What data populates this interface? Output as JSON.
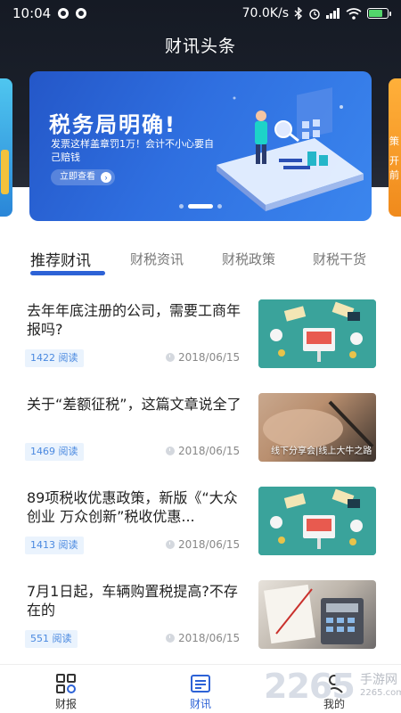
{
  "status_bar": {
    "time": "10:04",
    "network_speed": "70.0K/s",
    "battery_color": "#52d66b"
  },
  "header": {
    "title": "财讯头条"
  },
  "banner": {
    "heading": "税务局明确!",
    "description": "发票这样盖章罚1万！会计不小心要自己赔钱",
    "button_label": "立即查看",
    "active_slide": 2,
    "slide_count": 3,
    "right_peek_text": [
      "策",
      "开",
      "前"
    ]
  },
  "tabs": [
    {
      "label": "推荐财讯",
      "active": true
    },
    {
      "label": "财税资讯",
      "active": false
    },
    {
      "label": "财税政策",
      "active": false
    },
    {
      "label": "财税干货",
      "active": false
    }
  ],
  "news": [
    {
      "title": "去年年底注册的公司，需要工商年报吗?",
      "reads": "1422 阅读",
      "date": "2018/06/15",
      "thumb": "teal-illustration"
    },
    {
      "title": "关于“差额征税”，这篇文章说全了",
      "reads": "1469 阅读",
      "date": "2018/06/15",
      "thumb": "hand-photo",
      "thumb_caption": "线下分享会|线上大牛之路"
    },
    {
      "title": "89项税收优惠政策，新版《“大众创业 万众创新”税收优惠...",
      "reads": "1413 阅读",
      "date": "2018/06/15",
      "thumb": "teal-illustration"
    },
    {
      "title": "7月1日起，车辆购置税提高?不存在的",
      "reads": "551 阅读",
      "date": "2018/06/15",
      "thumb": "calculator-photo"
    }
  ],
  "bottom_nav": [
    {
      "label": "财报",
      "icon": "grid-icon",
      "active": false
    },
    {
      "label": "财讯",
      "icon": "news-icon",
      "active": true
    },
    {
      "label": "我的",
      "icon": "profile-icon",
      "active": false
    }
  ],
  "watermark": {
    "number": "2265",
    "text": "手游网",
    "url": "2265.com"
  },
  "colors": {
    "accent": "#2d62d6",
    "header_bg": "#1c212c",
    "badge_bg": "#eaf3fd",
    "badge_text": "#4a89e0"
  }
}
